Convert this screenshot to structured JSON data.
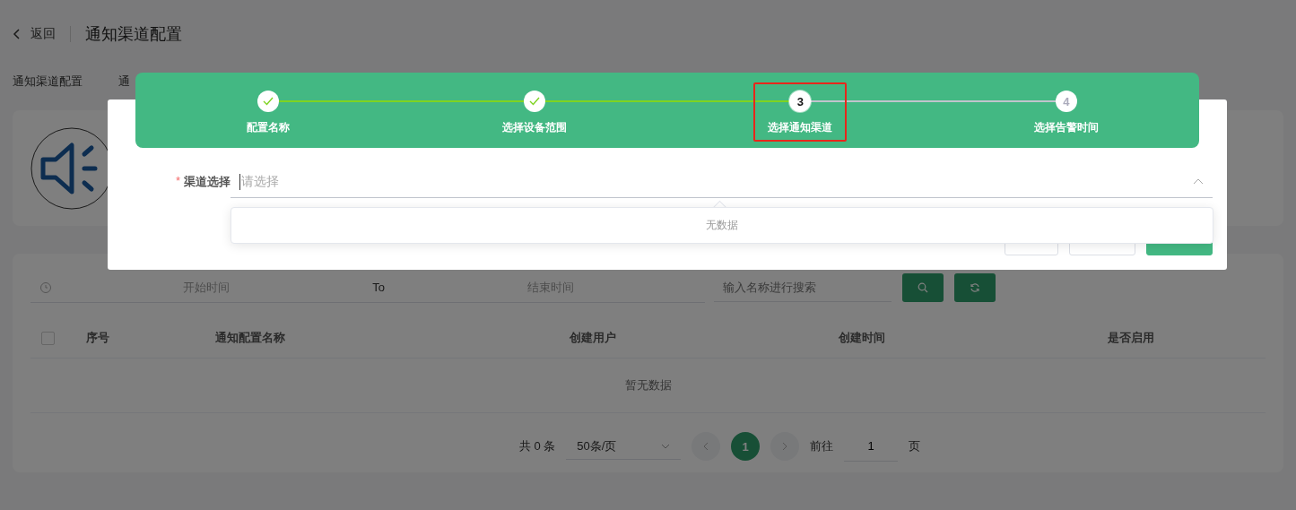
{
  "header": {
    "back": "返回",
    "title": "通知渠道配置"
  },
  "tabs": [
    {
      "label": "通知渠道配置",
      "selected": false
    },
    {
      "label": "通",
      "selected": false
    }
  ],
  "filters": {
    "start_placeholder": "开始时间",
    "separator": "To",
    "end_placeholder": "结束时间",
    "search_placeholder": "输入名称进行搜索"
  },
  "table": {
    "select_all_checked": false,
    "columns": [
      "序号",
      "通知配置名称",
      "创建用户",
      "创建时间",
      "是否启用"
    ],
    "empty_text": "暂无数据"
  },
  "pagination": {
    "total": "共 0 条",
    "page_size": "50条/页",
    "pages": [
      {
        "label": "1",
        "selected": true
      }
    ],
    "goto_label": "前往",
    "goto_value": "1",
    "goto_suffix": "页"
  },
  "dialog": {
    "steps": [
      {
        "label": "配置名称",
        "done": true,
        "selected": false,
        "highlighted": false
      },
      {
        "label": "选择设备范围",
        "done": true,
        "selected": false,
        "highlighted": false
      },
      {
        "label": "选择通知渠道",
        "done": false,
        "selected": true,
        "number": "3",
        "highlighted": true
      },
      {
        "label": "选择告警时间",
        "done": false,
        "selected": false,
        "number": "4",
        "highlighted": false
      }
    ],
    "field": {
      "label": "渠道选择",
      "required_mark": "*",
      "placeholder": "请选择",
      "open": true
    },
    "dropdown_empty": "无数据"
  }
}
